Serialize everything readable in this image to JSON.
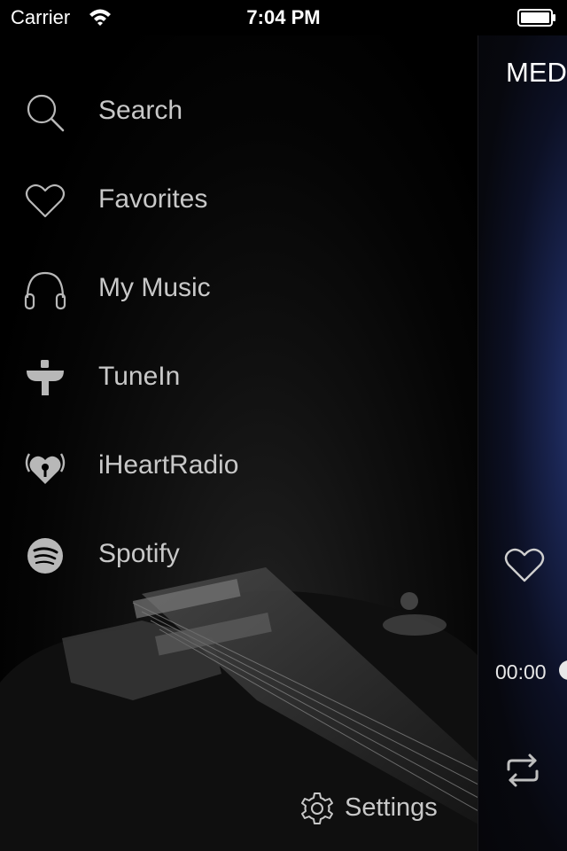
{
  "status_bar": {
    "carrier": "Carrier",
    "time": "7:04 PM"
  },
  "menu": {
    "items": [
      {
        "label": "Search",
        "icon": "search-icon"
      },
      {
        "label": "Favorites",
        "icon": "heart-icon"
      },
      {
        "label": "My Music",
        "icon": "headphones-icon"
      },
      {
        "label": "TuneIn",
        "icon": "tunein-icon"
      },
      {
        "label": "iHeartRadio",
        "icon": "iheartradio-icon"
      },
      {
        "label": "Spotify",
        "icon": "spotify-icon"
      }
    ],
    "settings_label": "Settings"
  },
  "player_peek": {
    "title": "MED",
    "elapsed": "00:00"
  },
  "colors": {
    "menu_text": "#c8c8c8",
    "background": "#000000",
    "peek_accent": "#2a3e7d"
  }
}
